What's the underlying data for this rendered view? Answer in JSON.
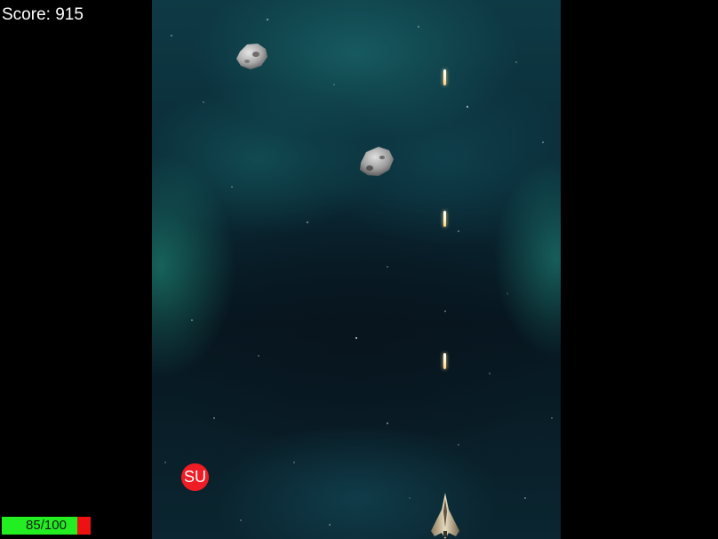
{
  "hud": {
    "score_text": "Score: 915",
    "health_text": "85/100",
    "health_fraction": 0.85
  },
  "powerup": {
    "label": "SU",
    "color": "#ee1c24"
  },
  "colors": {
    "health_good": "#22ee22",
    "health_bad": "#ee1111",
    "laser": "#fff0c0"
  },
  "sprites": {
    "asteroids": [
      "asteroid-icon",
      "asteroid-icon"
    ],
    "player": "spaceship-icon",
    "projectiles": [
      "laser-bolt",
      "laser-bolt",
      "laser-bolt"
    ]
  }
}
